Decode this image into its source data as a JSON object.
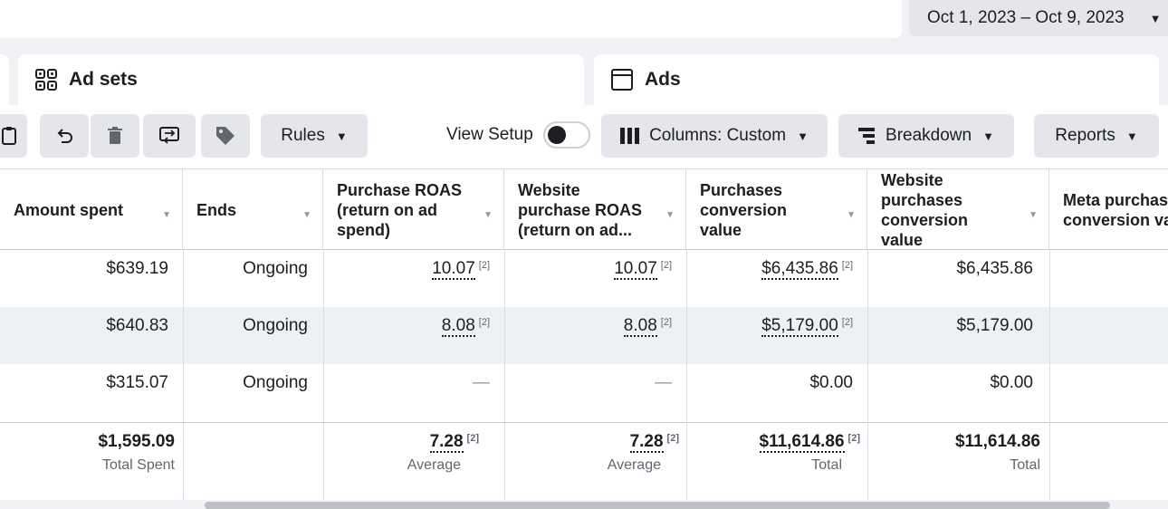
{
  "date_range": {
    "label": "Oct 1, 2023 – Oct 9, 2023"
  },
  "tabs": {
    "adsets": "Ad sets",
    "ads": "Ads"
  },
  "toolbar": {
    "rules": "Rules",
    "view_setup": "View Setup",
    "columns": "Columns: Custom",
    "breakdown": "Breakdown",
    "reports": "Reports"
  },
  "table": {
    "headers": {
      "amount_spent": "Amount spent",
      "ends": "Ends",
      "purchase_roas": "Purchase ROAS (return on ad spend)",
      "website_purchase_roas": "Website purchase ROAS (return on ad...",
      "purchases_conversion_value": "Purchases conversion value",
      "website_purchases_conversion_value": "Website purchases conversion value",
      "meta_purchases": "Meta purchas conversion va"
    },
    "rows": [
      {
        "amount_spent": "$639.19",
        "ends": "Ongoing",
        "purchase_roas": "10.07",
        "website_purchase_roas": "10.07",
        "purchases_conversion_value": "$6,435.86",
        "website_purchases_conversion_value": "$6,435.86"
      },
      {
        "amount_spent": "$640.83",
        "ends": "Ongoing",
        "purchase_roas": "8.08",
        "website_purchase_roas": "8.08",
        "purchases_conversion_value": "$5,179.00",
        "website_purchases_conversion_value": "$5,179.00"
      },
      {
        "amount_spent": "$315.07",
        "ends": "Ongoing",
        "purchase_roas": "—",
        "website_purchase_roas": "—",
        "purchases_conversion_value": "$0.00",
        "website_purchases_conversion_value": "$0.00"
      }
    ],
    "footnote_marker": "[2]",
    "totals": {
      "amount_spent": "$1,595.09",
      "amount_spent_sub": "Total Spent",
      "purchase_roas": "7.28",
      "purchase_roas_sub": "Average",
      "website_purchase_roas": "7.28",
      "website_purchase_roas_sub": "Average",
      "purchases_conversion_value": "$11,614.86",
      "purchases_conversion_value_sub": "Total",
      "website_purchases_conversion_value": "$11,614.86",
      "website_purchases_conversion_value_sub": "Total"
    }
  }
}
